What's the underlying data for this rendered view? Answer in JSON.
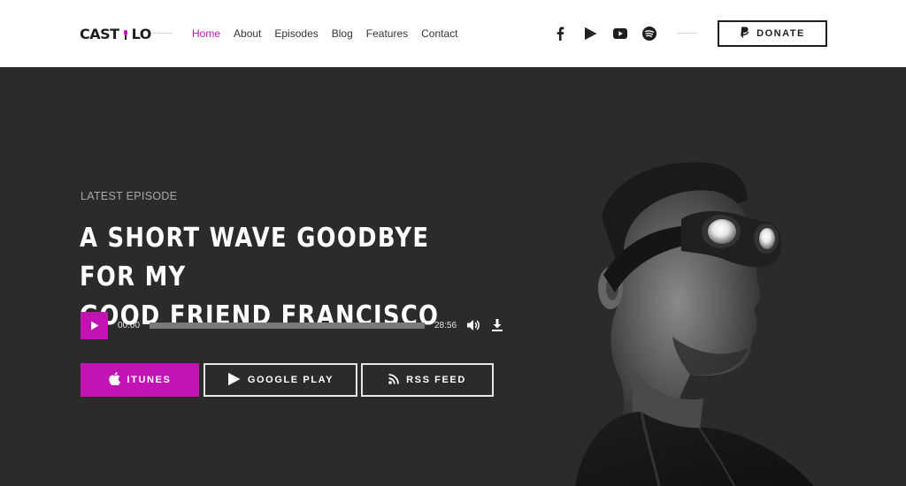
{
  "brand": {
    "logo_left": "CAST",
    "logo_right": "LO",
    "accent_color": "#c213b5"
  },
  "nav": {
    "items": [
      {
        "label": "Home",
        "active": true
      },
      {
        "label": "About",
        "active": false
      },
      {
        "label": "Episodes",
        "active": false
      },
      {
        "label": "Blog",
        "active": false
      },
      {
        "label": "Features",
        "active": false
      },
      {
        "label": "Contact",
        "active": false
      }
    ]
  },
  "social": {
    "icons": [
      "facebook-icon",
      "google-play-icon",
      "youtube-icon",
      "spotify-icon"
    ]
  },
  "donate": {
    "label": "DONATE",
    "icon": "paypal-icon"
  },
  "hero": {
    "eyebrow": "LATEST EPISODE",
    "title_line1": "A SHORT WAVE GOODBYE FOR MY",
    "title_line2": "GOOD FRIEND FRANCISCO"
  },
  "player": {
    "current_time": "00:00",
    "duration": "28:56",
    "progress": 0
  },
  "buttons": {
    "itunes": "ITUNES",
    "google_play": "GOOGLE PLAY",
    "rss": "RSS FEED"
  }
}
